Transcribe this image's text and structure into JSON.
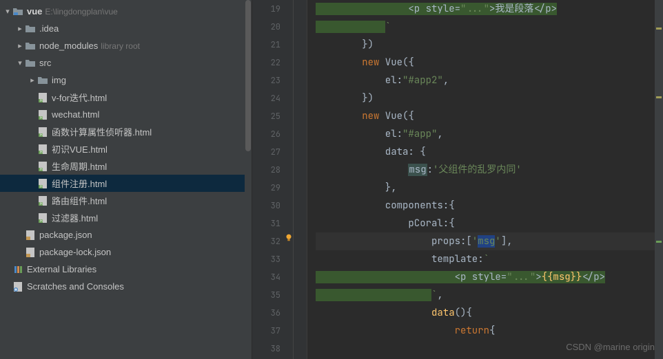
{
  "project": {
    "root_name": "vue",
    "root_path": "E:\\lingdongplan\\vue",
    "tree": [
      {
        "kind": "folder-root",
        "name": "vue",
        "path_hint": "E:\\lingdongplan\\vue",
        "depth": 0,
        "open": true
      },
      {
        "kind": "folder",
        "name": ".idea",
        "depth": 1,
        "open": false
      },
      {
        "kind": "folder",
        "name": "node_modules",
        "hint": "library root",
        "depth": 1,
        "open": false
      },
      {
        "kind": "folder",
        "name": "src",
        "depth": 1,
        "open": true
      },
      {
        "kind": "folder",
        "name": "img",
        "depth": 2,
        "open": false
      },
      {
        "kind": "html",
        "name": "v-for迭代.html",
        "depth": 2
      },
      {
        "kind": "html",
        "name": "wechat.html",
        "depth": 2
      },
      {
        "kind": "html",
        "name": "函数计算属性侦听器.html",
        "depth": 2
      },
      {
        "kind": "html",
        "name": "初识VUE.html",
        "depth": 2
      },
      {
        "kind": "html",
        "name": "生命周期.html",
        "depth": 2
      },
      {
        "kind": "html",
        "name": "组件注册.html",
        "depth": 2,
        "selected": true
      },
      {
        "kind": "html",
        "name": "路由组件.html",
        "depth": 2
      },
      {
        "kind": "html",
        "name": "过滤器.html",
        "depth": 2
      },
      {
        "kind": "json",
        "name": "package.json",
        "depth": 1
      },
      {
        "kind": "json",
        "name": "package-lock.json",
        "depth": 1
      },
      {
        "kind": "lib",
        "name": "External Libraries",
        "depth": 0
      },
      {
        "kind": "scratch",
        "name": "Scratches and Consoles",
        "depth": 0
      }
    ]
  },
  "editor": {
    "first_line": 19,
    "lines": [
      {
        "n": 19,
        "seg": [
          {
            "c": "hl-bg",
            "t": "                "
          },
          {
            "c": "hl-bg txt",
            "t": "<p style="
          },
          {
            "c": "hl-bg s",
            "t": "\"...\""
          },
          {
            "c": "hl-bg txt",
            "t": ">我是段落</p>"
          }
        ]
      },
      {
        "n": 20,
        "seg": [
          {
            "c": "hl-bg",
            "t": "            "
          },
          {
            "c": "s",
            "t": "`"
          }
        ]
      },
      {
        "n": 21,
        "seg": [
          {
            "c": "txt",
            "t": "        })"
          }
        ]
      },
      {
        "n": 22,
        "seg": [
          {
            "c": "txt",
            "t": "        "
          },
          {
            "c": "k",
            "t": "new"
          },
          {
            "c": "txt",
            "t": " Vue({"
          }
        ]
      },
      {
        "n": 23,
        "seg": [
          {
            "c": "txt",
            "t": "            el:"
          },
          {
            "c": "s",
            "t": "\"#app2\""
          },
          {
            "c": "txt",
            "t": ","
          }
        ]
      },
      {
        "n": 24,
        "seg": [
          {
            "c": "txt",
            "t": "        })"
          }
        ]
      },
      {
        "n": 25,
        "seg": [
          {
            "c": "txt",
            "t": "        "
          },
          {
            "c": "k",
            "t": "new"
          },
          {
            "c": "txt",
            "t": " Vue({"
          }
        ]
      },
      {
        "n": 26,
        "seg": [
          {
            "c": "txt",
            "t": "            el:"
          },
          {
            "c": "s",
            "t": "\"#app\""
          },
          {
            "c": "txt",
            "t": ","
          }
        ]
      },
      {
        "n": 27,
        "seg": [
          {
            "c": "txt",
            "t": "            data: {"
          }
        ]
      },
      {
        "n": 28,
        "seg": [
          {
            "c": "txt",
            "t": "                "
          },
          {
            "c": "msg-box",
            "t": "msg"
          },
          {
            "c": "txt",
            "t": ":"
          },
          {
            "c": "s",
            "t": "'父组件的乱罗内同'"
          }
        ]
      },
      {
        "n": 29,
        "seg": [
          {
            "c": "txt",
            "t": "            },"
          }
        ]
      },
      {
        "n": 30,
        "seg": [
          {
            "c": "txt",
            "t": "            components:{"
          }
        ]
      },
      {
        "n": 31,
        "seg": [
          {
            "c": "txt",
            "t": "                pCoral:{"
          }
        ]
      },
      {
        "n": 32,
        "seg": [
          {
            "c": "txt",
            "t": "                    props:["
          },
          {
            "c": "s",
            "t": "'"
          },
          {
            "c": "sel s",
            "t": "msg"
          },
          {
            "c": "s",
            "t": "'"
          },
          {
            "c": "txt",
            "t": "],"
          }
        ],
        "bulb": true,
        "caret": true
      },
      {
        "n": 33,
        "seg": [
          {
            "c": "txt",
            "t": "                    template:"
          },
          {
            "c": "s",
            "t": "`"
          }
        ]
      },
      {
        "n": 34,
        "seg": [
          {
            "c": "hl-bg",
            "t": "                        "
          },
          {
            "c": "hl-bg txt",
            "t": "<p style="
          },
          {
            "c": "hl-bg s",
            "t": "\"...\""
          },
          {
            "c": "hl-bg txt",
            "t": ">"
          },
          {
            "c": "hl-bg yel",
            "t": "{{msg}}"
          },
          {
            "c": "hl-bg txt",
            "t": "</p>"
          }
        ]
      },
      {
        "n": 35,
        "seg": [
          {
            "c": "hl-bg",
            "t": "                    "
          },
          {
            "c": "s",
            "t": "`"
          },
          {
            "c": "txt",
            "t": ","
          }
        ]
      },
      {
        "n": 36,
        "seg": [
          {
            "c": "txt",
            "t": "                    "
          },
          {
            "c": "yel",
            "t": "data"
          },
          {
            "c": "txt",
            "t": "(){"
          }
        ]
      },
      {
        "n": 37,
        "seg": [
          {
            "c": "txt",
            "t": "                        "
          },
          {
            "c": "k",
            "t": "return"
          },
          {
            "c": "txt",
            "t": "{"
          }
        ]
      },
      {
        "n": 38,
        "seg": [
          {
            "c": "txt",
            "t": ""
          }
        ]
      }
    ]
  },
  "watermark": "CSDN @marine origin"
}
